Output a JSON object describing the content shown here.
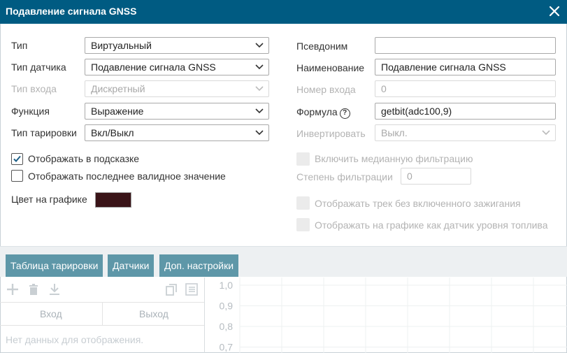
{
  "window": {
    "title": "Подавление сигнала GNSS"
  },
  "left": {
    "type": {
      "label": "Тип",
      "value": "Виртуальный"
    },
    "sensor_type": {
      "label": "Тип датчика",
      "value": "Подавление сигнала GNSS"
    },
    "input_type": {
      "label": "Тип входа",
      "value": "Дискретный"
    },
    "function": {
      "label": "Функция",
      "value": "Выражение"
    },
    "calibration_type": {
      "label": "Тип тарировки",
      "value": "Вкл/Выкл"
    },
    "show_in_tooltip": {
      "label": "Отображать в подсказке",
      "checked": true
    },
    "show_last_valid": {
      "label": "Отображать последнее валидное значение",
      "checked": false
    },
    "chart_color": {
      "label": "Цвет на графике",
      "color": "#3a1418"
    }
  },
  "right": {
    "alias": {
      "label": "Псевдоним",
      "value": ""
    },
    "name": {
      "label": "Наименование",
      "value": "Подавление сигнала GNSS"
    },
    "input_number": {
      "label": "Номер входа",
      "value": "0"
    },
    "formula": {
      "label": "Формула",
      "value": "getbit(adc100,9)",
      "help_icon": "question-icon"
    },
    "invert": {
      "label": "Инвертировать",
      "value": "Выкл."
    },
    "median_filter": {
      "label": "Включить медианную фильтрацию",
      "checked": false
    },
    "filter_degree": {
      "label": "Степень фильтрации",
      "value": "0"
    },
    "track_without_ignition": {
      "label": "Отображать трек без включенного зажигания",
      "checked": false
    },
    "fuel_level_on_chart": {
      "label": "Отображать на графике как датчик уровня топлива",
      "checked": false
    }
  },
  "tabs": [
    {
      "label": "Таблица тарировки",
      "active": true
    },
    {
      "label": "Датчики",
      "active": false
    },
    {
      "label": "Доп. настройки",
      "active": false
    }
  ],
  "calibration": {
    "toolbar_icons": [
      "plus-icon",
      "trash-icon",
      "download-icon",
      "copy-icon",
      "list-icon"
    ],
    "columns": [
      "Вход",
      "Выход"
    ],
    "empty_text": "Нет данных для отображения."
  },
  "chart_data": {
    "type": "line",
    "y_ticks": [
      "1,0",
      "0,9",
      "0,8",
      "0,7"
    ],
    "ylim": [
      0.7,
      1.0
    ],
    "grid": true,
    "series": []
  },
  "colors": {
    "title_bar": "#005b82",
    "tab": "#5e97a8",
    "swatch": "#3a1418"
  }
}
